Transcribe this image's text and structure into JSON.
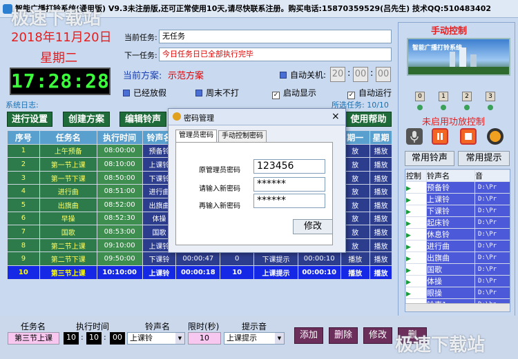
{
  "window": {
    "title": "智能广播打铃系统(通用版) V9.3未注册版,还可正常使用10天,请尽快联系注册。购买电话:15870359529(吕先生) 技术QQ:510483402"
  },
  "watermark": {
    "top": "极速下载站",
    "bottom": "极速下载站"
  },
  "datetime": {
    "date": "2018年11月20日",
    "weekday": "星期二",
    "time": "17:28:28"
  },
  "tasks": {
    "current_label": "当前任务:",
    "current_value": "无任务",
    "next_label": "下一任务:",
    "next_value": "今日任务日已全部执行完毕",
    "plan_label": "当前方案:",
    "plan_value": "示范方案"
  },
  "auto_shutdown": {
    "label": "自动关机:",
    "h": "20",
    "m": "00",
    "s": "00"
  },
  "options": {
    "holiday": "已经放假",
    "weekend": "周末不打",
    "autoshow": "启动显示",
    "autorun": "自动运行"
  },
  "log": {
    "label": "系统日志:",
    "selected": "所选任务: 10/10"
  },
  "toolbar": {
    "b1": "进行设置",
    "b2": "创建方案",
    "b3": "编辑铃声",
    "b4": "使用帮助"
  },
  "table": {
    "headers": [
      "序号",
      "任务名",
      "执行时间",
      "铃声名",
      "",
      "",
      "",
      "",
      "期一",
      "星期"
    ],
    "rows": [
      [
        "1",
        "上午预备",
        "08:00:00",
        "预备铃",
        "",
        "",
        "",
        "",
        "放",
        "播放"
      ],
      [
        "2",
        "第一节上课",
        "08:10:00",
        "上课铃",
        "",
        "",
        "",
        "",
        "放",
        "播放"
      ],
      [
        "3",
        "第一节下课",
        "08:50:00",
        "下课铃",
        "",
        "",
        "",
        "",
        "放",
        "播放"
      ],
      [
        "4",
        "进行曲",
        "08:51:00",
        "进行曲",
        "",
        "",
        "",
        "",
        "放",
        "播放"
      ],
      [
        "5",
        "出旗曲",
        "08:52:00",
        "出旗曲",
        "",
        "",
        "",
        "",
        "放",
        "播放"
      ],
      [
        "6",
        "早操",
        "08:52:30",
        "体操",
        "",
        "",
        "",
        "",
        "放",
        "播放"
      ],
      [
        "7",
        "国歌",
        "08:53:00",
        "国歌",
        "",
        "",
        "",
        "",
        "放",
        "播放"
      ],
      [
        "8",
        "第二节上课",
        "09:10:00",
        "上课铃",
        "",
        "",
        "",
        "",
        "放",
        "播放"
      ],
      [
        "9",
        "第二节下课",
        "09:50:00",
        "下课铃",
        "00:00:47",
        "0",
        "下课提示",
        "00:00:10",
        "播放",
        "播放"
      ],
      [
        "10",
        "第三节上课",
        "10:10:00",
        "上课铃",
        "00:00:18",
        "10",
        "上课提示",
        "00:00:10",
        "播放",
        "播放"
      ]
    ]
  },
  "dialog": {
    "title": "密码管理",
    "tab1": "管理员密码",
    "tab2": "手动控制密码",
    "orig_label": "原管理员密码",
    "orig_value": "123456",
    "new_label": "请输入新密码",
    "new_value": "******",
    "again_label": "再输入新密码",
    "again_value": "******",
    "modify": "修改",
    "close": "×"
  },
  "right": {
    "title": "手动控制",
    "banner": "智能广播打铃系统",
    "channels": [
      "0",
      "1",
      "2",
      "3"
    ],
    "amp_status": "未启用功放控制",
    "common_ring": "常用铃声",
    "common_tip": "常用提示",
    "list_headers": [
      "控制",
      "铃声名",
      "音"
    ],
    "list": [
      [
        "预备铃",
        "D:\\Pr"
      ],
      [
        "上课铃",
        "D:\\Pr"
      ],
      [
        "下课铃",
        "D:\\Pr"
      ],
      [
        "起床铃",
        "D:\\Pr"
      ],
      [
        "休息铃",
        "D:\\Pr"
      ],
      [
        "进行曲",
        "D:\\Pr"
      ],
      [
        "出旗曲",
        "D:\\Pr"
      ],
      [
        "国歌",
        "D:\\Pr"
      ],
      [
        "体操",
        "D:\\Pr"
      ],
      [
        "眼操",
        "D:\\Pr"
      ],
      [
        "铃声1",
        "D:\\ba"
      ]
    ]
  },
  "bottom": {
    "name_label": "任务名",
    "time_label": "执行时间",
    "ring_label": "铃声名",
    "limit_label": "限时(秒)",
    "tip_label": "提示音",
    "name_value": "第三节上课",
    "h": "10",
    "m": "10",
    "s": "00",
    "ring_value": "上课铃",
    "limit_value": "10",
    "tip_value": "上课提示",
    "add": "添加",
    "delete": "删除",
    "modify": "修改",
    "extra": "删"
  }
}
